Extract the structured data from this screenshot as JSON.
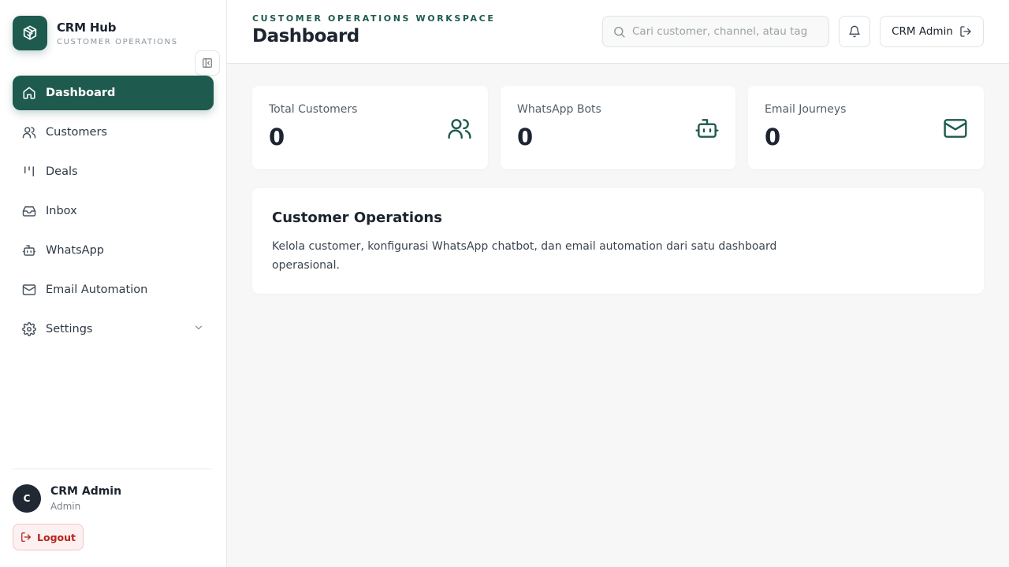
{
  "brand": {
    "name": "CRM Hub",
    "subtitle": "CUSTOMER OPERATIONS"
  },
  "sidebar": {
    "items": [
      {
        "label": "Dashboard",
        "icon": "home-icon",
        "active": true
      },
      {
        "label": "Customers",
        "icon": "users-icon"
      },
      {
        "label": "Deals",
        "icon": "kanban-icon"
      },
      {
        "label": "Inbox",
        "icon": "inbox-icon"
      },
      {
        "label": "WhatsApp",
        "icon": "bot-icon"
      },
      {
        "label": "Email Automation",
        "icon": "mail-icon"
      },
      {
        "label": "Settings",
        "icon": "gear-icon",
        "expandable": true
      }
    ],
    "user": {
      "initial": "C",
      "name": "CRM Admin",
      "role": "Admin"
    },
    "logout_label": "Logout"
  },
  "header": {
    "eyebrow": "CUSTOMER OPERATIONS WORKSPACE",
    "title": "Dashboard",
    "search_placeholder": "Cari customer, channel, atau tag",
    "account_label": "CRM Admin"
  },
  "stats": [
    {
      "label": "Total Customers",
      "value": "0",
      "icon": "users-icon"
    },
    {
      "label": "WhatsApp Bots",
      "value": "0",
      "icon": "bot-icon"
    },
    {
      "label": "Email Journeys",
      "value": "0",
      "icon": "mail-icon"
    }
  ],
  "overview": {
    "title": "Customer Operations",
    "description": "Kelola customer, konfigurasi WhatsApp chatbot, dan email automation dari satu dashboard operasional."
  },
  "colors": {
    "brand": "#1e5a4e",
    "danger": "#b3261e",
    "background": "#f6f7f6"
  }
}
